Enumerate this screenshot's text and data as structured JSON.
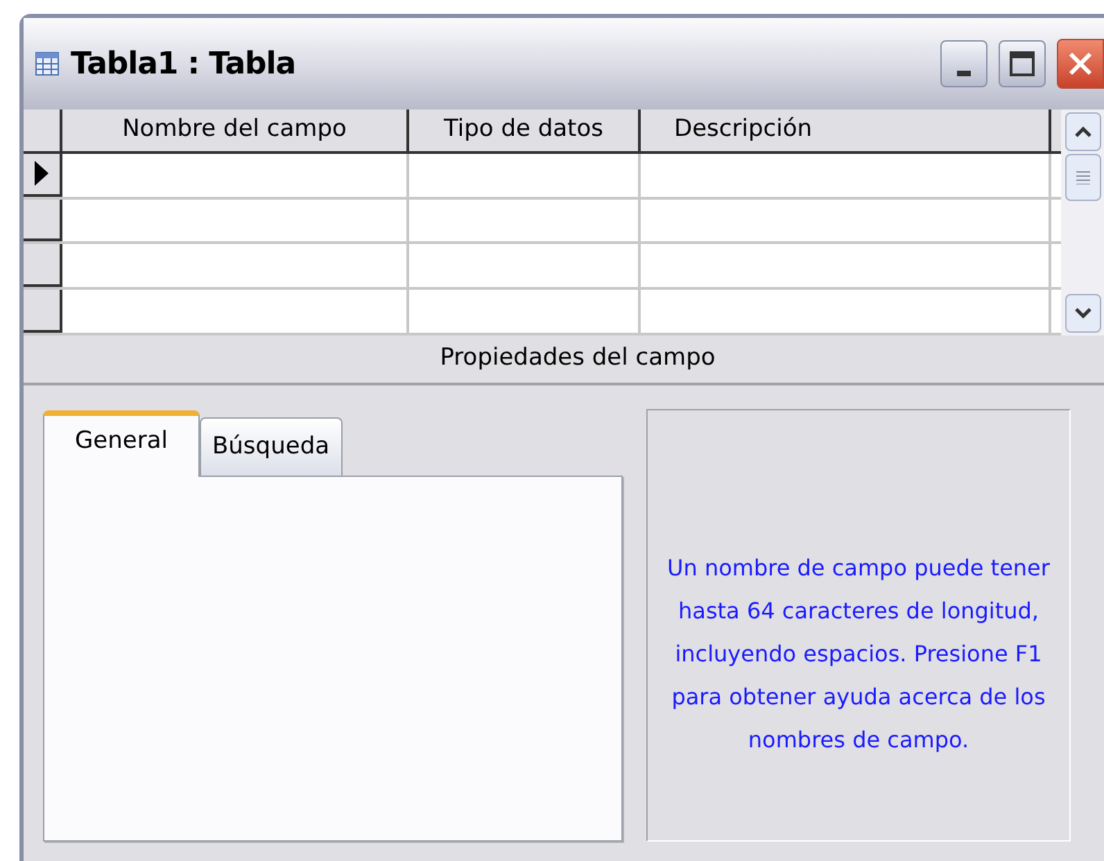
{
  "window": {
    "title": "Tabla1 : Tabla"
  },
  "grid": {
    "columns": [
      "Nombre del campo",
      "Tipo de datos",
      "Descripción"
    ],
    "rows": [
      {
        "selected": true
      },
      {
        "selected": false
      },
      {
        "selected": false
      },
      {
        "selected": false
      }
    ]
  },
  "properties_label": "Propiedades del campo",
  "tabs": [
    {
      "label": "General",
      "selected": true
    },
    {
      "label": "Búsqueda",
      "selected": false
    }
  ],
  "help_text": "Un nombre de campo puede tener hasta 64 caracteres de longitud, incluyendo espacios. Presione F1 para obtener ayuda acerca de los nombres de campo."
}
